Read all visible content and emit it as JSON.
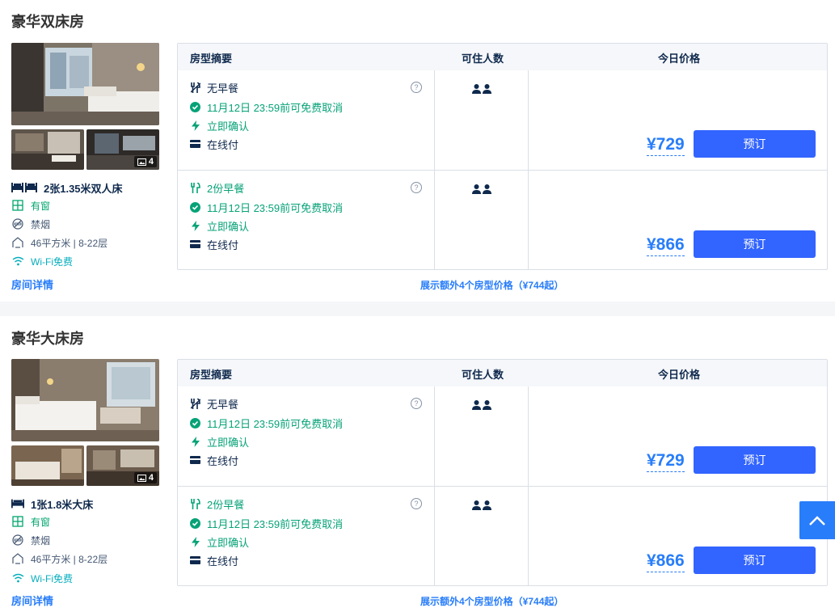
{
  "rooms": [
    {
      "title": "豪华双床房",
      "photo_count": "4",
      "bed": "2张1.35米双人床",
      "window": "有窗",
      "smoking": "禁烟",
      "area": "46平方米 | 8-22层",
      "wifi": "Wi-Fi免费",
      "detail_link": "房间详情",
      "more_prices": "展示额外4个房型价格（¥744起）",
      "rates": [
        {
          "meal": "无早餐",
          "cancel": "11月12日 23:59前可免费取消",
          "confirm": "立即确认",
          "payment": "在线付",
          "price": "¥729",
          "book": "预订"
        },
        {
          "meal": "2份早餐",
          "cancel": "11月12日 23:59前可免费取消",
          "confirm": "立即确认",
          "payment": "在线付",
          "price": "¥866",
          "book": "预订"
        }
      ]
    },
    {
      "title": "豪华大床房",
      "photo_count": "4",
      "bed": "1张1.8米大床",
      "window": "有窗",
      "smoking": "禁烟",
      "area": "46平方米 | 8-22层",
      "wifi": "Wi-Fi免费",
      "detail_link": "房间详情",
      "more_prices": "展示额外4个房型价格（¥744起）",
      "rates": [
        {
          "meal": "无早餐",
          "cancel": "11月12日 23:59前可免费取消",
          "confirm": "立即确认",
          "payment": "在线付",
          "price": "¥729",
          "book": "预订"
        },
        {
          "meal": "2份早餐",
          "cancel": "11月12日 23:59前可免费取消",
          "confirm": "立即确认",
          "payment": "在线付",
          "price": "¥866",
          "book": "预订"
        }
      ]
    }
  ],
  "table_headers": {
    "summary": "房型摘要",
    "guests": "可住人数",
    "price": "今日价格"
  },
  "colors": {
    "accent": "#287dfa",
    "button": "#3264ff",
    "green": "#06a277"
  }
}
